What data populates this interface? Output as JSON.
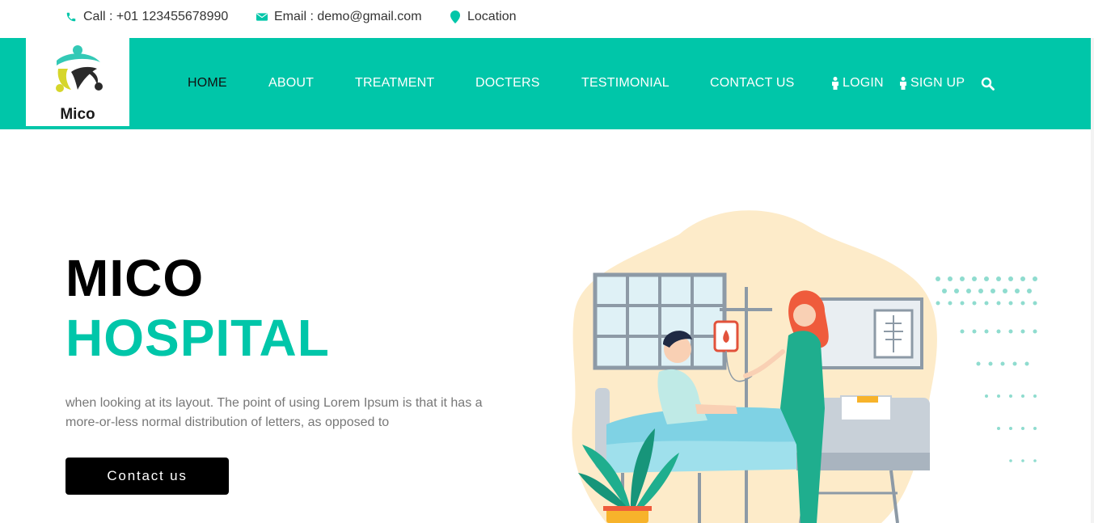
{
  "topbar": {
    "call": "Call : +01 123455678990",
    "email": "Email : demo@gmail.com",
    "location": "Location",
    "icons": [
      "phone-icon",
      "envelope-icon",
      "map-marker-icon"
    ]
  },
  "brand": {
    "name": "Mico",
    "color_primary": "#00c6a9"
  },
  "nav": {
    "items": [
      {
        "label": "HOME",
        "active": true
      },
      {
        "label": "ABOUT"
      },
      {
        "label": "TREATMENT"
      },
      {
        "label": "DOCTERS"
      },
      {
        "label": "TESTIMONIAL"
      },
      {
        "label": "CONTACT US"
      }
    ],
    "login": "LOGIN",
    "signup": "SIGN UP",
    "search_icon": "search-icon"
  },
  "hero": {
    "title_line1": "MICO",
    "title_line2": "HOSPITAL",
    "description": "when looking at its layout. The point of using Lorem Ipsum is that it has a more-or-less normal distribution of letters, as opposed to",
    "button": "Contact us"
  }
}
